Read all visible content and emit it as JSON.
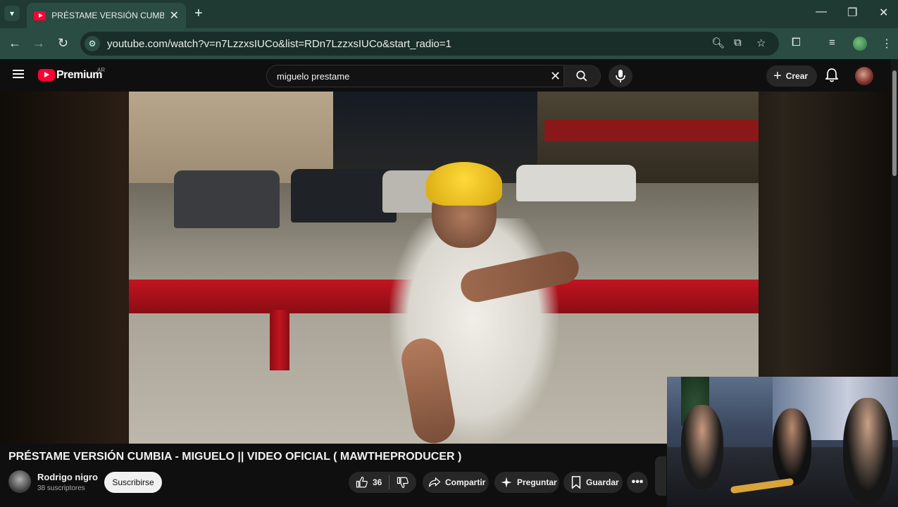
{
  "browser": {
    "tab_title": "PRÉSTAME VERSIÓN CUMBIA - MI",
    "url": "youtube.com/watch?v=n7LzzxsIUCo&list=RDn7LzzxsIUCo&start_radio=1"
  },
  "youtube": {
    "logo_text": "Premium",
    "country": "AR",
    "search_query": "miguelo prestame",
    "create_label": "Crear"
  },
  "video": {
    "title": "PRÉSTAME VERSIÓN CUMBIA - MIGUELO || VIDEO OFICIAL ( MAWTHEPRODUCER )",
    "channel_name": "Rodrigo nigro",
    "subscribers": "38 suscriptores",
    "subscribe_label": "Suscribirse",
    "likes": "36",
    "share_label": "Compartir",
    "ask_label": "Preguntar",
    "save_label": "Guardar"
  },
  "colors": {
    "youtube_red": "#ff0033",
    "chrome_green": "#2b4c43",
    "background": "#0f0f0f"
  }
}
